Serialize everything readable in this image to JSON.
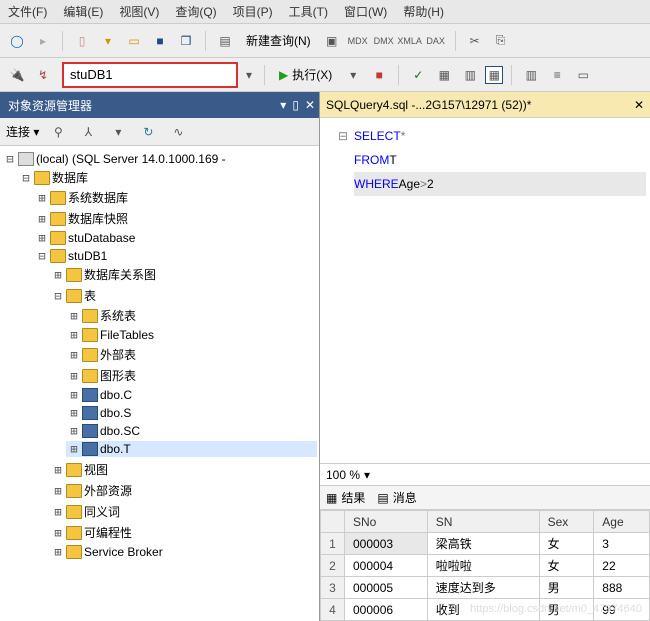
{
  "menu": [
    "文件(F)",
    "编辑(E)",
    "视图(V)",
    "查询(Q)",
    "项目(P)",
    "工具(T)",
    "窗口(W)",
    "帮助(H)"
  ],
  "toolbar1": {
    "new_query": "新建查询(N)"
  },
  "toolbar2": {
    "db_selected": "stuDB1",
    "execute": "执行(X)"
  },
  "panel_title": "对象资源管理器",
  "connect_label": "连接 ▾",
  "tree": {
    "root": "(local) (SQL Server 14.0.1000.169 - ",
    "db_folder": "数据库",
    "sys_db": "系统数据库",
    "db_snap": "数据库快照",
    "studb": "stuDatabase",
    "studb1": "stuDB1",
    "studb1_children": {
      "diagram": "数据库关系图",
      "tables": "表",
      "table_children": {
        "sys_tables": "系统表",
        "filetables": "FileTables",
        "ext_tables": "外部表",
        "graph_tables": "图形表",
        "dbo_c": "dbo.C",
        "dbo_s": "dbo.S",
        "dbo_sc": "dbo.SC",
        "dbo_t": "dbo.T"
      },
      "views": "视图",
      "ext_res": "外部资源",
      "synonyms": "同义词",
      "programmability": "可编程性",
      "service_broker": "Service Broker"
    }
  },
  "tab": {
    "title": "SQLQuery4.sql -...2G157\\12971 (52))*"
  },
  "sql": {
    "l1_kw": "SELECT",
    "l1_op": " *",
    "l2_kw": "FROM",
    "l2_id": " T",
    "l3_kw": "WHERE",
    "l3_id": " Age",
    "l3_op": ">",
    "l3_val": "2"
  },
  "zoom": "100 %",
  "result_tabs": {
    "results": "结果",
    "messages": "消息"
  },
  "grid": {
    "cols": [
      "SNo",
      "SN",
      "Sex",
      "Age"
    ],
    "rows": [
      {
        "n": "1",
        "SNo": "000003",
        "SN": "梁高铁",
        "Sex": "女",
        "Age": "3"
      },
      {
        "n": "2",
        "SNo": "000004",
        "SN": "啦啦啦",
        "Sex": "女",
        "Age": "22"
      },
      {
        "n": "3",
        "SNo": "000005",
        "SN": "速度达到多",
        "Sex": "男",
        "Age": "888"
      },
      {
        "n": "4",
        "SNo": "000006",
        "SN": "收到",
        "Sex": "男",
        "Age": "99"
      }
    ]
  },
  "watermark": "https://blog.csdn.net/m0_47974640"
}
